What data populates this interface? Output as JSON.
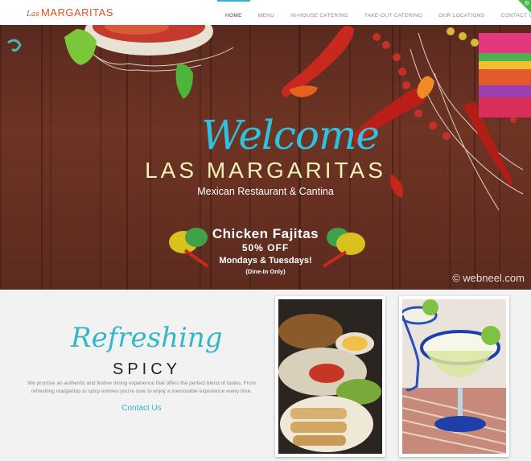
{
  "nav": {
    "logo_script": "Las",
    "logo_main": "MARGARITAS",
    "items": [
      {
        "label": "HOME"
      },
      {
        "label": "MENU"
      },
      {
        "label": "IN-HOUSE CATERING"
      },
      {
        "label": "TAKE-OUT CATERING"
      },
      {
        "label": "OUR LOCATIONS"
      },
      {
        "label": "CONTACT US"
      }
    ],
    "active": "HOME"
  },
  "hero": {
    "welcome": "Welcome",
    "brand": "LAS MARGARITAS",
    "tagline": "Mexican Restaurant & Cantina",
    "promo_title": "Chicken Fajitas",
    "promo_discount": "50% OFF",
    "promo_days": "Mondays & Tuesdays!",
    "promo_note": "(Dine-In Only)",
    "watermark": "© webneel.com"
  },
  "about": {
    "script_heading": "Refreshing",
    "heading": "SPICY",
    "description": "We promise an authentic and festive dining experience that offers the perfect blend of tastes. From refreshing margaritas to spicy entrées you're sure to enjoy a memorable experience every time.",
    "contact_label": "Contact Us"
  },
  "colors": {
    "accent": "#33b7c9",
    "logo": "#d0541f",
    "brand_text": "#f4f1b6",
    "wood": "#5e2c20"
  }
}
